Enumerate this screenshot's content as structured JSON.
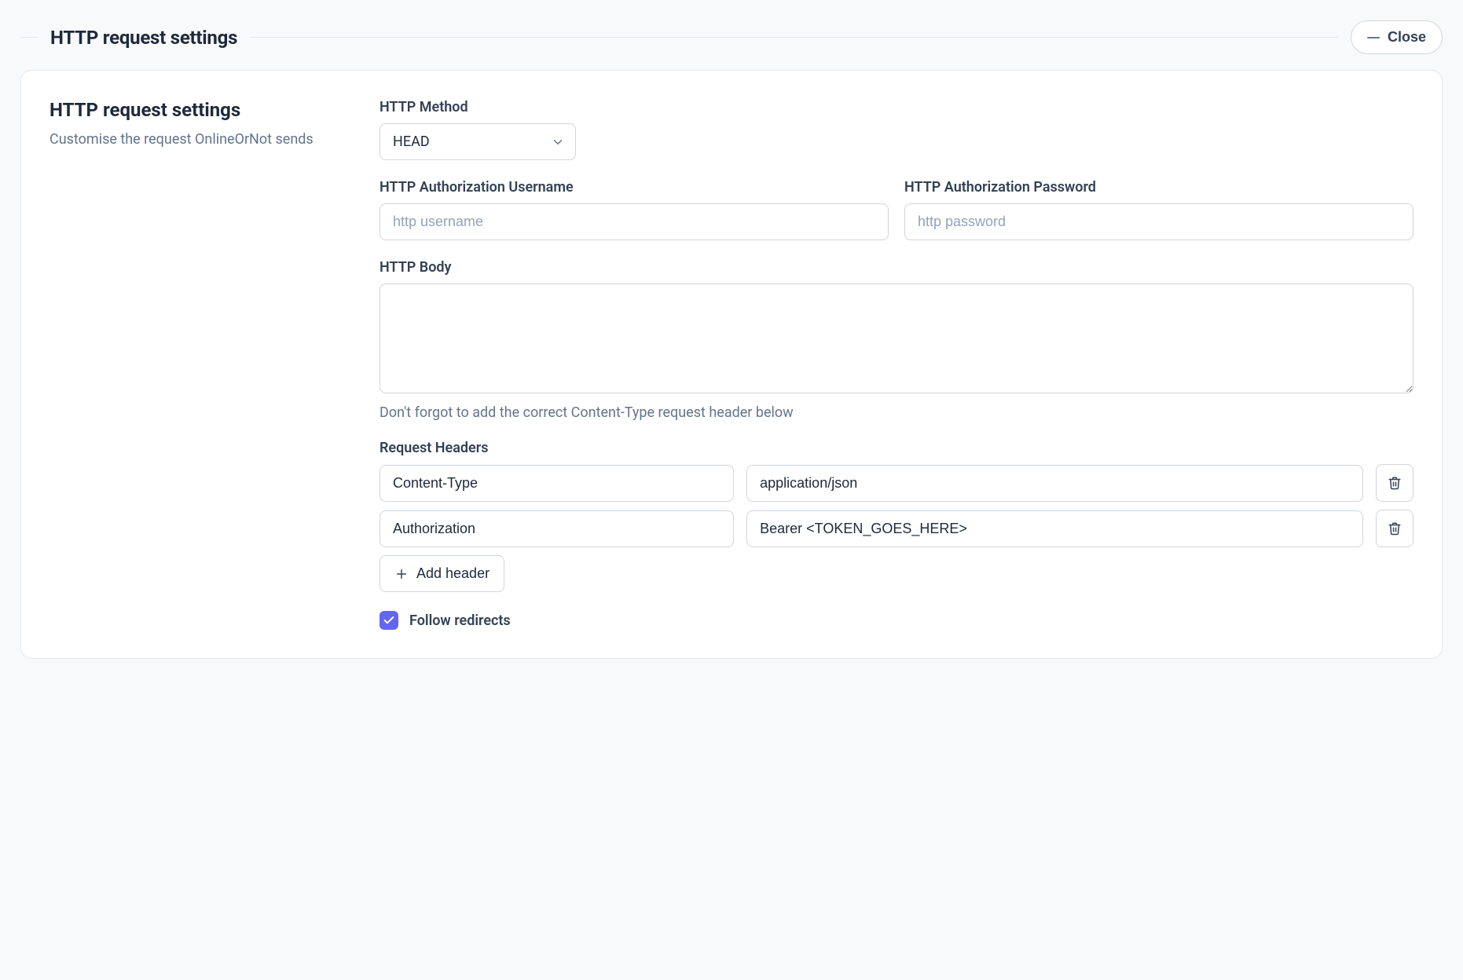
{
  "header": {
    "title": "HTTP request settings",
    "close_label": "Close"
  },
  "section": {
    "title": "HTTP request settings",
    "subtitle": "Customise the request OnlineOrNot sends"
  },
  "http_method": {
    "label": "HTTP Method",
    "value": "HEAD"
  },
  "auth_username": {
    "label": "HTTP Authorization Username",
    "placeholder": "http username"
  },
  "auth_password": {
    "label": "HTTP Authorization Password",
    "placeholder": "http password"
  },
  "http_body": {
    "label": "HTTP Body",
    "hint": "Don't forgot to add the correct Content-Type request header below"
  },
  "request_headers": {
    "label": "Request Headers",
    "items": [
      {
        "key": "Content-Type",
        "value": "application/json"
      },
      {
        "key": "Authorization",
        "value": "Bearer <TOKEN_GOES_HERE>"
      }
    ],
    "add_label": "Add header"
  },
  "follow_redirects": {
    "label": "Follow redirects",
    "checked": true
  }
}
